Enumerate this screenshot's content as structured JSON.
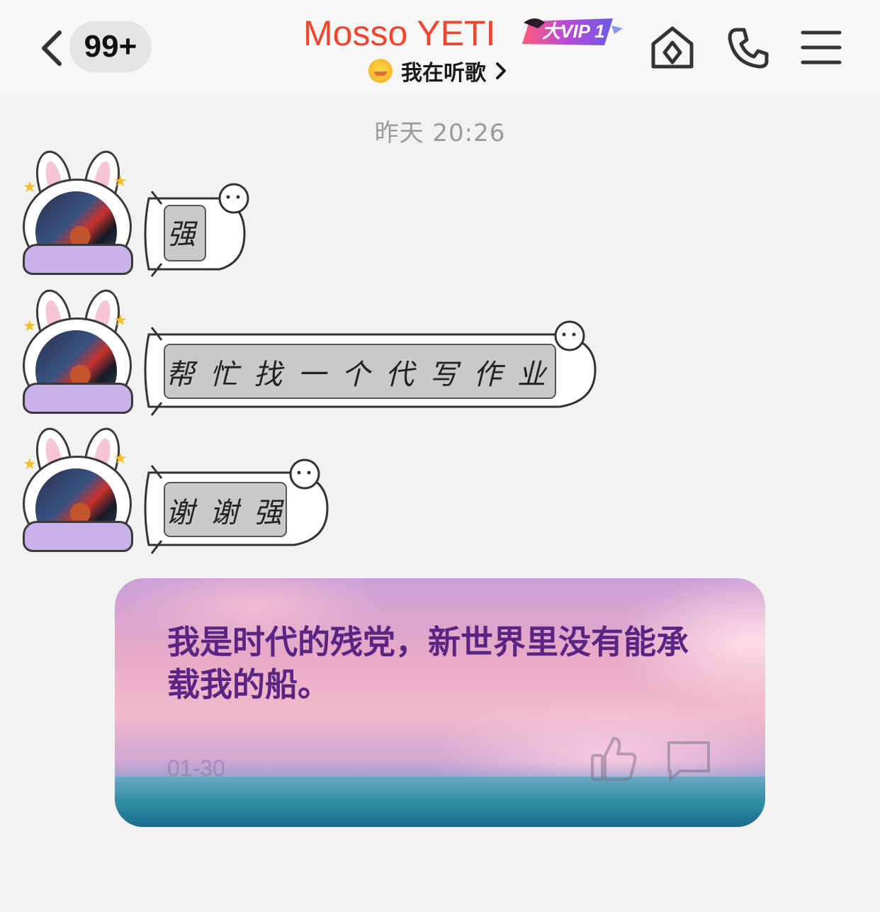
{
  "header": {
    "unread_count": "99+",
    "contact_name": "Mosso YETI",
    "vip_label": "大VIP 1",
    "status_text": "我在听歌",
    "icons": [
      "chevron-left-icon",
      "home-diamond-icon",
      "phone-icon",
      "menu-icon"
    ]
  },
  "chat": {
    "time_divider": "昨天 20:26",
    "messages": [
      {
        "sender": "other",
        "text": "强"
      },
      {
        "sender": "other",
        "text": "帮忙找一个代写作业"
      },
      {
        "sender": "other",
        "text": "谢谢强"
      }
    ]
  },
  "card": {
    "quote": "我是时代的残党，新世界里没有能承载我的船。",
    "date": "01-30"
  },
  "colors": {
    "name_red": "#f0462e",
    "quote_purple": "#5a2483",
    "background": "#f2f2f3"
  }
}
